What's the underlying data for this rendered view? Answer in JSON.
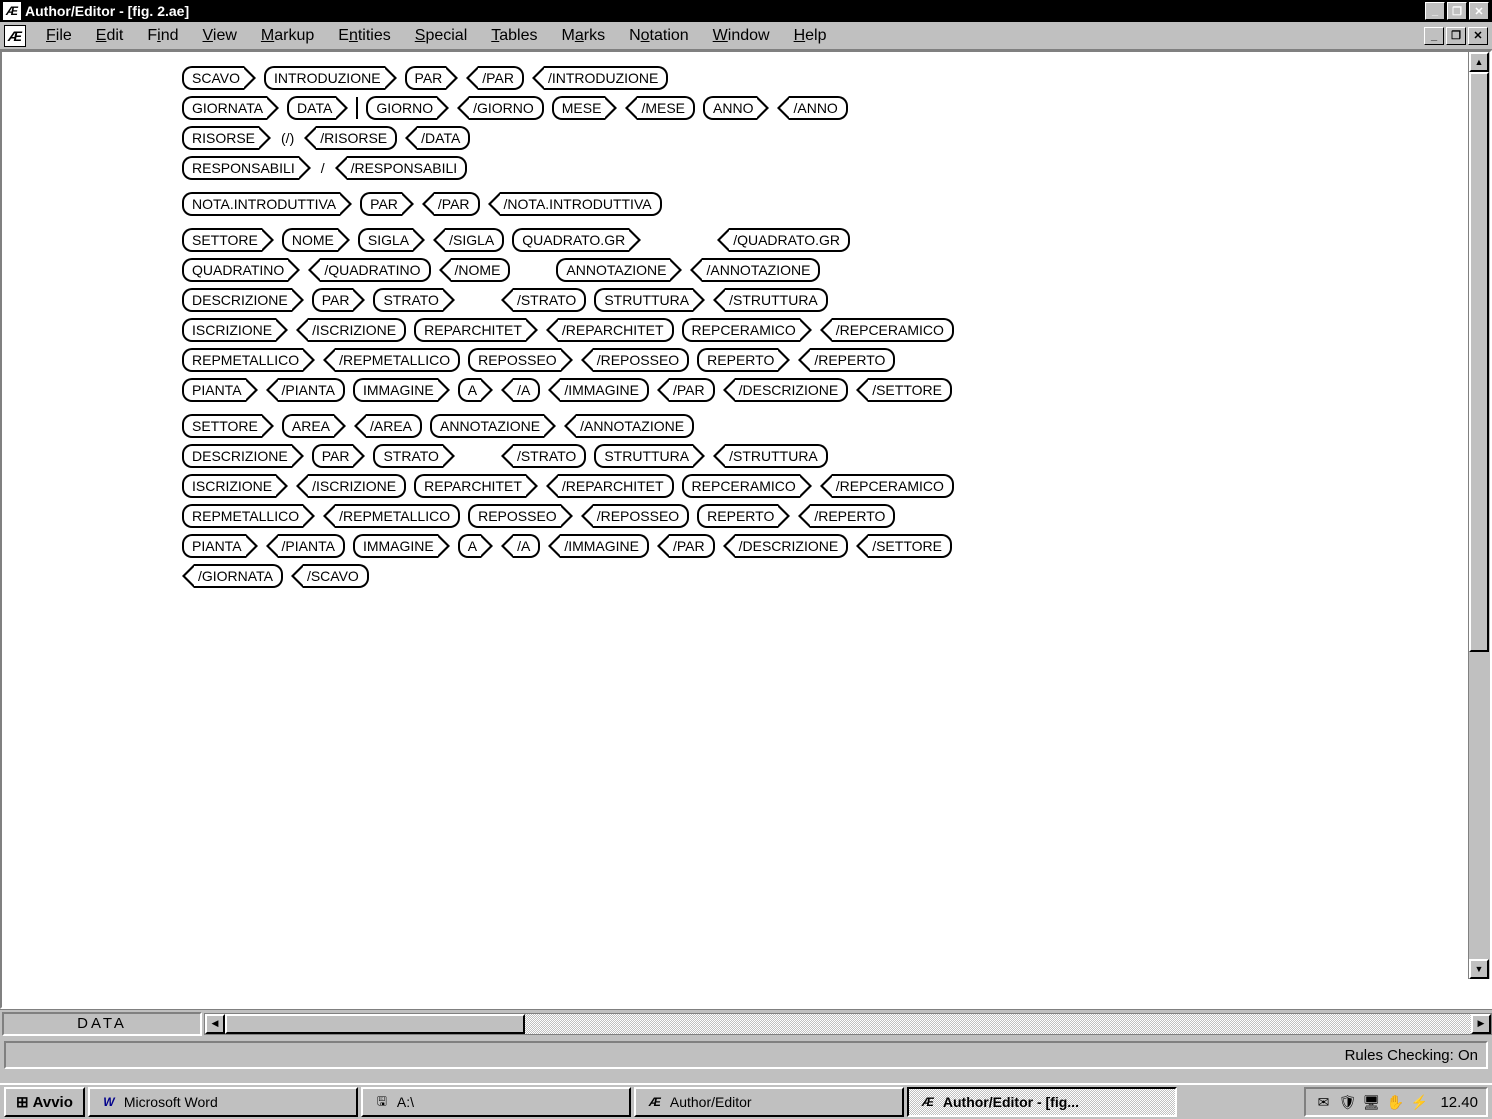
{
  "titlebar": {
    "icon": "Æ",
    "text": "Author/Editor - [fig. 2.ae]"
  },
  "menu": {
    "icon": "Æ",
    "items": [
      "File",
      "Edit",
      "Find",
      "View",
      "Markup",
      "Entities",
      "Special",
      "Tables",
      "Marks",
      "Notation",
      "Window",
      "Help"
    ]
  },
  "tags": {
    "row1": [
      "SCAVO",
      "INTRODUZIONE",
      "PAR",
      "/PAR",
      "/INTRODUZIONE"
    ],
    "row2": [
      "GIORNATA",
      "DATA",
      "GIORNO",
      "/GIORNO",
      "MESE",
      "/MESE",
      "ANNO",
      "/ANNO"
    ],
    "row3": [
      "RISORSE",
      "/RISORSE",
      "/DATA"
    ],
    "row3_text": "(/)",
    "row4": [
      "RESPONSABILI",
      "/RESPONSABILI"
    ],
    "row4_text": "/",
    "row5": [
      "NOTA.INTRODUTTIVA",
      "PAR",
      "/PAR",
      "/NOTA.INTRODUTTIVA"
    ],
    "row6": [
      "SETTORE",
      "NOME",
      "SIGLA",
      "/SIGLA",
      "QUADRATO.GR",
      "/QUADRATO.GR"
    ],
    "row7": [
      "QUADRATINO",
      "/QUADRATINO",
      "/NOME",
      "ANNOTAZIONE",
      "/ANNOTAZIONE"
    ],
    "row8": [
      "DESCRIZIONE",
      "PAR",
      "STRATO",
      "/STRATO",
      "STRUTTURA",
      "/STRUTTURA"
    ],
    "row9": [
      "ISCRIZIONE",
      "/ISCRIZIONE",
      "REPARCHITET",
      "/REPARCHITET",
      "REPCERAMICO",
      "/REPCERAMICO"
    ],
    "row10": [
      "REPMETALLICO",
      "/REPMETALLICO",
      "REPOSSEO",
      "/REPOSSEO",
      "REPERTO",
      "/REPERTO"
    ],
    "row11": [
      "PIANTA",
      "/PIANTA",
      "IMMAGINE",
      "A",
      "/A",
      "/IMMAGINE",
      "/PAR",
      "/DESCRIZIONE",
      "/SETTORE"
    ],
    "row12": [
      "SETTORE",
      "AREA",
      "/AREA",
      "ANNOTAZIONE",
      "/ANNOTAZIONE"
    ],
    "row13": [
      "DESCRIZIONE",
      "PAR",
      "STRATO",
      "/STRATO",
      "STRUTTURA",
      "/STRUTTURA"
    ],
    "row14": [
      "ISCRIZIONE",
      "/ISCRIZIONE",
      "REPARCHITET",
      "/REPARCHITET",
      "REPCERAMICO",
      "/REPCERAMICO"
    ],
    "row15": [
      "REPMETALLICO",
      "/REPMETALLICO",
      "REPOSSEO",
      "/REPOSSEO",
      "REPERTO",
      "/REPERTO"
    ],
    "row16": [
      "PIANTA",
      "/PIANTA",
      "IMMAGINE",
      "A",
      "/A",
      "/IMMAGINE",
      "/PAR",
      "/DESCRIZIONE",
      "/SETTORE"
    ],
    "row17": [
      "/GIORNATA",
      "/SCAVO"
    ]
  },
  "element_path": "DATA",
  "statusbar": {
    "rules": "Rules Checking: On"
  },
  "taskbar": {
    "start": "Avvio",
    "items": [
      {
        "icon": "W",
        "label": "Microsoft Word",
        "active": false
      },
      {
        "icon": "💾",
        "label": "A:\\",
        "active": false
      },
      {
        "icon": "Æ",
        "label": "Author/Editor",
        "active": false
      },
      {
        "icon": "Æ",
        "label": "Author/Editor - [fig...",
        "active": true
      }
    ],
    "clock": "12.40"
  }
}
